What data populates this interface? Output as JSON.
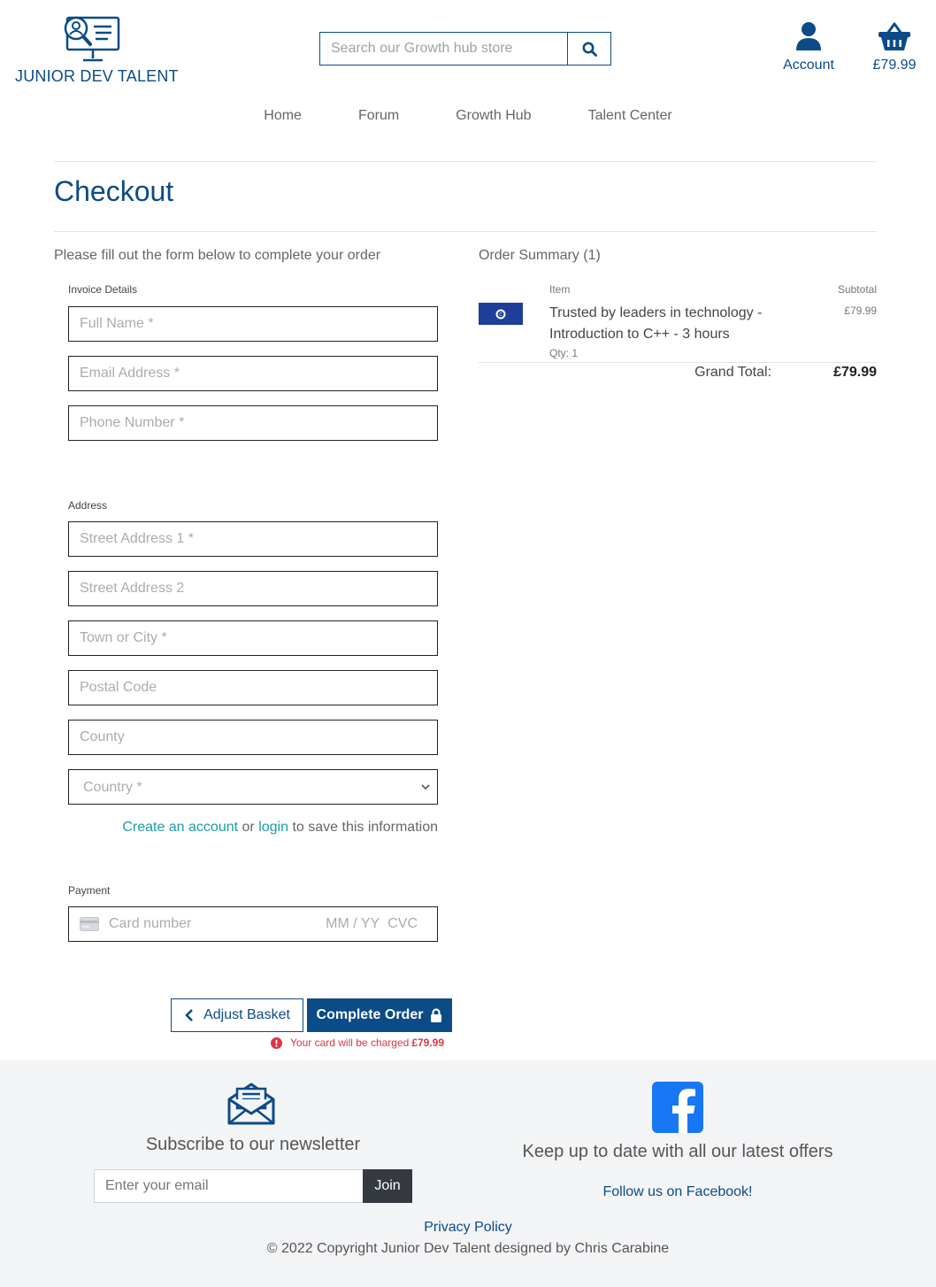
{
  "brand": {
    "name": "JUNIOR DEV TALENT",
    "color": "#0b4b87"
  },
  "search": {
    "placeholder": "Search our Growth hub store"
  },
  "header": {
    "account_label": "Account",
    "basket_total": "£79.99"
  },
  "nav": {
    "items": [
      "Home",
      "Forum",
      "Growth Hub",
      "Talent Center"
    ]
  },
  "page": {
    "title": "Checkout",
    "intro": "Please fill out the form below to complete your order"
  },
  "form": {
    "invoice_label": "Invoice Details",
    "invoice_fields": {
      "full_name": "Full Name *",
      "email": "Email Address *",
      "phone": "Phone Number *"
    },
    "address_label": "Address",
    "address_fields": {
      "street1": "Street Address 1 *",
      "street2": "Street Address 2",
      "town": "Town or City *",
      "postcode": "Postal Code",
      "county": "County",
      "country": "Country *"
    },
    "save_info": {
      "create_link": "Create an account",
      "or": "or",
      "login_link": "login",
      "suffix": "to save this information"
    },
    "payment_label": "Payment",
    "card": {
      "number_placeholder": "Card number",
      "expiry_placeholder": "MM / YY",
      "cvc_placeholder": "CVC"
    }
  },
  "actions": {
    "adjust_label": "Adjust Basket",
    "complete_label": "Complete Order",
    "charge_text": "Your card will be charged",
    "charge_amount": "£79.99",
    "error_color": "#dc3545"
  },
  "order_summary": {
    "title": "Order Summary (1)",
    "col_item": "Item",
    "col_subtotal": "Subtotal",
    "items": [
      {
        "name": "Trusted by leaders in technology - Introduction to C++ - 3 hours",
        "price": "£79.99",
        "qty": "Qty: 1"
      }
    ],
    "grand_total_label": "Grand Total:",
    "grand_total": "£79.99"
  },
  "footer": {
    "newsletter_title": "Subscribe to our newsletter",
    "email_placeholder": "Enter your email",
    "join_label": "Join",
    "facebook_title": "Keep up to date with all our latest offers",
    "facebook_link": "Follow us on Facebook!",
    "privacy": "Privacy Policy",
    "copyright": "© 2022 Copyright Junior Dev Talent designed by Chris Carabine",
    "facebook_color": "#1877f2"
  }
}
